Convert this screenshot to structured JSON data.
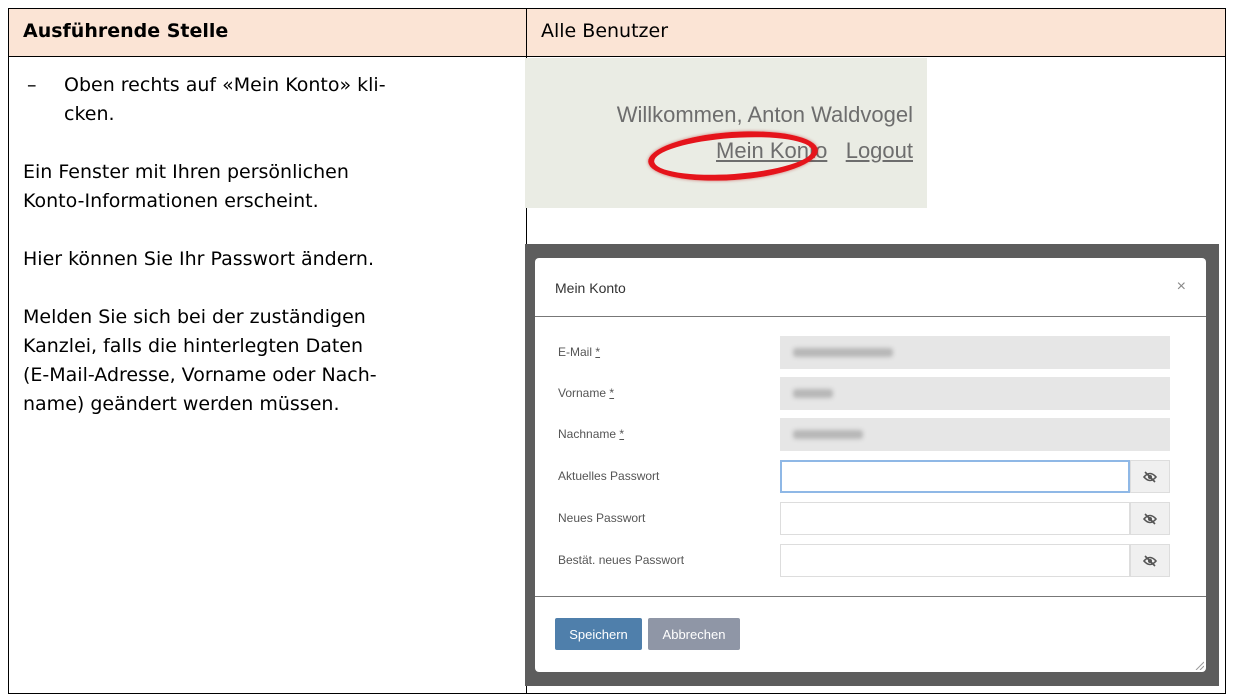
{
  "table": {
    "header_left": "Ausführende Stelle",
    "header_right": "Alle Benutzer"
  },
  "instructions": {
    "bullet_dash": "–",
    "bullet_line1": "Oben rechts auf «Mein Konto» kli-",
    "bullet_line2": "cken.",
    "para1_line1": "Ein Fenster mit Ihren persönlichen",
    "para1_line2": "Konto-Informationen erscheint.",
    "para2": "Hier können Sie Ihr Passwort ändern.",
    "para3_line1": "Melden Sie sich bei der zuständigen",
    "para3_line2": "Kanzlei, falls die hinterlegten Daten",
    "para3_line3": "(E-Mail-Adresse, Vorname oder Nach-",
    "para3_line4": "name) geändert werden müssen."
  },
  "login_screenshot": {
    "welcome": "Willkommen, Anton Waldvogel",
    "account_link": "Mein Konto",
    "logout_link": "Logout",
    "highlight_color": "#e5141b"
  },
  "modal": {
    "title": "Mein Konto",
    "close": "×",
    "fields": [
      {
        "label": "E-Mail",
        "required": "*"
      },
      {
        "label": "Vorname",
        "required": "*"
      },
      {
        "label": "Nachname",
        "required": "*"
      }
    ],
    "password_fields": [
      {
        "label": "Aktuelles Passwort",
        "value": ""
      },
      {
        "label": "Neues Passwort",
        "value": ""
      },
      {
        "label": "Bestät. neues Passwort",
        "value": ""
      }
    ],
    "save_button": "Speichern",
    "cancel_button": "Abbrechen",
    "colors": {
      "save": "#4f7fab",
      "cancel": "#8f96a6"
    }
  }
}
